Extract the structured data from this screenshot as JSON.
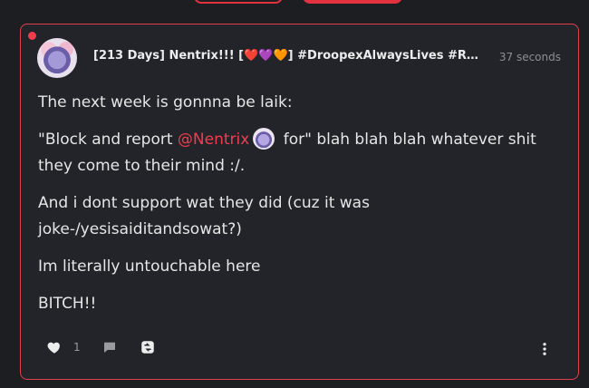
{
  "post": {
    "username": "[213 Days] Nentrix!!! [❤️💜🧡] #DroopexAlwaysLives #Ra...",
    "timestamp": "37 seconds",
    "paragraphs": {
      "p1": "The next week is gonnna be laik:",
      "p2_before": "\"Block and report ",
      "p2_mention": "@Nentrix",
      "p2_after": " for\" blah blah blah whatever shit they come to their mind :/.",
      "p3": "And i dont support wat they did (cuz it was joke-/yesisaiditandsowat?)",
      "p4": "Im literally untouchable here",
      "p5": "BITCH!!"
    },
    "likes_count": "1"
  },
  "colors": {
    "accent": "#e2323f",
    "background": "#1d1e22",
    "card": "#23242a",
    "text": "#e6e6e6",
    "muted": "#8d8e94"
  },
  "icons": {
    "like": "heart-icon",
    "comment": "comment-icon",
    "share": "share-icon",
    "more": "more-vertical-icon"
  }
}
